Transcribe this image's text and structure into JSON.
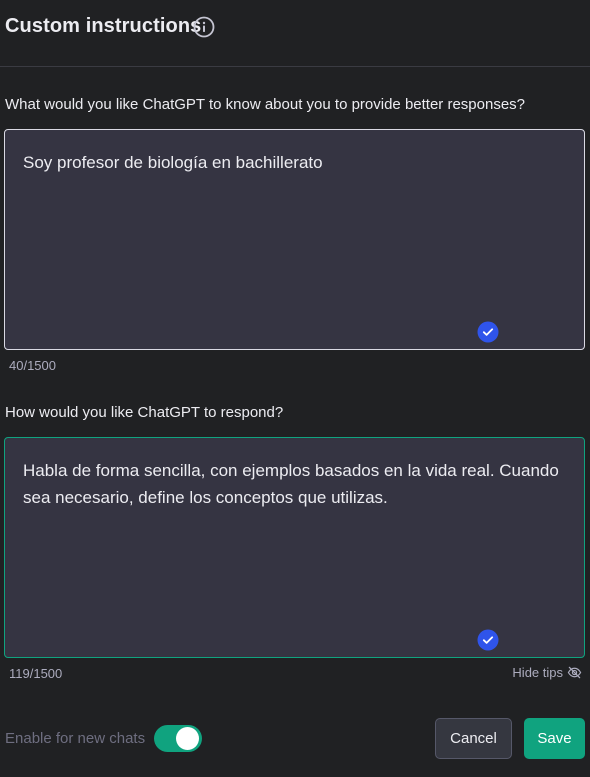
{
  "header": {
    "title": "Custom instructions"
  },
  "about": {
    "question": "What would you like ChatGPT to know about you to provide better responses?",
    "value": "Soy profesor de biología en bachillerato",
    "counter": "40/1500"
  },
  "respond": {
    "question": "How would you like ChatGPT to respond?",
    "value": "Habla de forma sencilla, con ejemplos basados en la vida real. Cuando sea necesario, define los conceptos que utilizas.",
    "counter": "119/1500"
  },
  "tips": {
    "hide_label": "Hide tips"
  },
  "footer": {
    "enable_label": "Enable for new chats",
    "enable_on": true,
    "cancel_label": "Cancel",
    "save_label": "Save"
  },
  "colors": {
    "accent": "#10a37f",
    "check": "#2f54eb",
    "background": "#202123",
    "field": "#353442"
  },
  "icons": {
    "info": "info-icon",
    "check": "check-circle-icon",
    "hide_tips": "eye-off-icon"
  }
}
